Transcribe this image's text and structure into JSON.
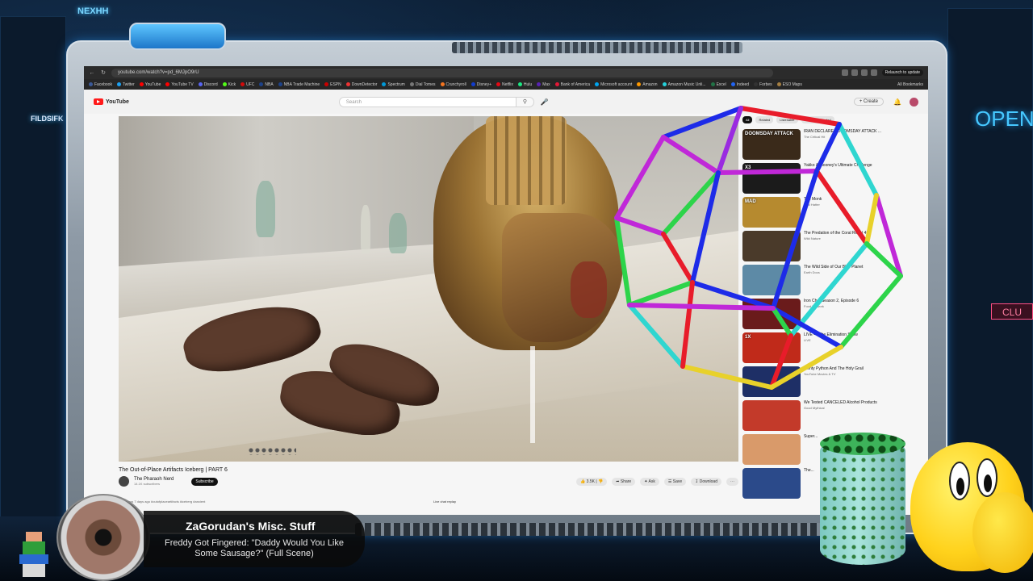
{
  "browser": {
    "url": "youtube.com/watch?v=pd_6MJpO9rU",
    "relaunch_label": "Relaunch to update",
    "bookmarks": [
      {
        "label": "Facebook",
        "color": "#3b5998"
      },
      {
        "label": "Twitter",
        "color": "#1da1f2"
      },
      {
        "label": "YouTube",
        "color": "#ff0000"
      },
      {
        "label": "YouTube TV",
        "color": "#ff0000"
      },
      {
        "label": "Discord",
        "color": "#5865f2"
      },
      {
        "label": "Kick",
        "color": "#53fc18"
      },
      {
        "label": "UFC",
        "color": "#d20a0a"
      },
      {
        "label": "NBA",
        "color": "#1d428a"
      },
      {
        "label": "NBA Trade Machine",
        "color": "#1d428a"
      },
      {
        "label": "ESPN",
        "color": "#cc0000"
      },
      {
        "label": "DownDetector",
        "color": "#e33"
      },
      {
        "label": "Spectrum",
        "color": "#0099d8"
      },
      {
        "label": "Dial Tomes",
        "color": "#777"
      },
      {
        "label": "Crunchyroll",
        "color": "#f47521"
      },
      {
        "label": "Disney+",
        "color": "#113ccf"
      },
      {
        "label": "Netflix",
        "color": "#e50914"
      },
      {
        "label": "Hulu",
        "color": "#1ce783"
      },
      {
        "label": "Max",
        "color": "#5822b4"
      },
      {
        "label": "Bank of America",
        "color": "#e31837"
      },
      {
        "label": "Microsoft account",
        "color": "#00a4ef"
      },
      {
        "label": "Amazon",
        "color": "#ff9900"
      },
      {
        "label": "Amazon Music Unli...",
        "color": "#25d1da"
      },
      {
        "label": "Excel",
        "color": "#217346"
      },
      {
        "label": "Indeed",
        "color": "#2164f3"
      },
      {
        "label": "Forbes",
        "color": "#333"
      },
      {
        "label": "ESO Maps",
        "color": "#a57f42"
      }
    ],
    "all_bookmarks": "All Bookmarks"
  },
  "youtube": {
    "logo_text": "YouTube",
    "search_placeholder": "Search",
    "create_label": "+ Create",
    "chips": [
      "All",
      "Related",
      "Listenable",
      "Recently uploaded"
    ],
    "video": {
      "title": "The Out-of-Place Artifacts Iceberg | PART 6",
      "channel": "The Pharaoh Nerd",
      "subs": "14.1K subscribers",
      "subscribe": "Subscribe",
      "likes": "3.5K",
      "share": "Share",
      "ask": "Ask",
      "save": "Save",
      "download": "Download",
      "meta": "89K views  7 days ago  #outofplaceartifacts #iceberg #ancient",
      "live_chat": "Live chat replay"
    },
    "recommendations": [
      {
        "thumb_text": "DOOMSDAY ATTACK",
        "title": "IRAN DECLARES DOOMSDAY ATTACK ...",
        "sub": "The Critical Hit",
        "color": "#3a2a1a"
      },
      {
        "thumb_text": "X3",
        "title": "Yakko & Mooney's Ultimate Challenge",
        "sub": "LIVE",
        "color": "#1b1b1b"
      },
      {
        "thumb_text": "MAD",
        "title": "The Monk",
        "sub": "Mad Hatter",
        "color": "#b68a2f"
      },
      {
        "thumb_text": "",
        "title": "The Predation of the Coral Reef | 4K",
        "sub": "Wild Nature",
        "color": "#4a3a2a"
      },
      {
        "thumb_text": "",
        "title": "The Wild Side of Our Blue Planet",
        "sub": "Earth Docs",
        "color": "#5d8aa6"
      },
      {
        "thumb_text": "",
        "title": "Iron Chef Season 2, Episode 6",
        "sub": "Food Network",
        "color": "#6a1b1b"
      },
      {
        "thumb_text": "1X",
        "title": "LIVE — The Elimination Show",
        "sub": "LIVE",
        "color": "#c02a1a"
      },
      {
        "thumb_text": "",
        "title": "Monty Python And The Holy Grail",
        "sub": "YouTube Movies & TV",
        "color": "#1e2f66"
      },
      {
        "thumb_text": "",
        "title": "We Tested CANCELED Alcohol Products",
        "sub": "Good Mythical",
        "color": "#c33a2a"
      },
      {
        "thumb_text": "",
        "title": "Super...",
        "sub": "",
        "color": "#d99a6a"
      },
      {
        "thumb_text": "",
        "title": "The...",
        "sub": "",
        "color": "#2b4a8a"
      }
    ]
  },
  "now_playing": {
    "channel": "ZaGorudan's Misc. Stuff",
    "song": "Freddy Got Fingered: \"Daddy Would You Like Some Sausage?\" (Full Scene)"
  },
  "scene": {
    "open_sign": "OPEN",
    "clu_sign": "CLU",
    "neon_top": "NEXHH",
    "neon_left": "FILDSIFK"
  }
}
